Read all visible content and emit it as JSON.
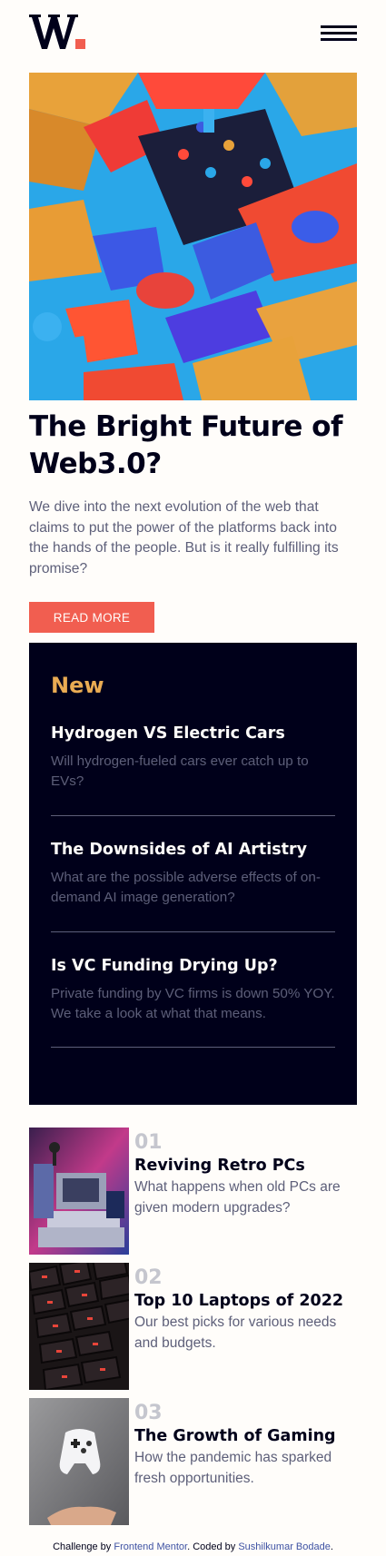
{
  "brand": {
    "logo_letter": "W",
    "logo_dot_color": "#f15e50"
  },
  "header": {
    "menu_icon": "hamburger-icon"
  },
  "hero": {
    "image_icon": "abstract-3d-shapes-image",
    "title": "The Bright Future of Web3.0?",
    "description": "We dive into the next evolution of the web that claims to put the power of the platforms back into the hands of the people. But is it really fulfilling its promise?",
    "button_label": "READ MORE"
  },
  "new_section": {
    "heading": "New",
    "items": [
      {
        "title": "Hydrogen VS Electric Cars",
        "description": "Will hydrogen-fueled cars ever catch up to EVs?"
      },
      {
        "title": "The Downsides of AI Artistry",
        "description": "What are the possible adverse effects of on-demand AI image generation?"
      },
      {
        "title": "Is VC Funding Drying Up?",
        "description": "Private funding by VC firms is down 50% YOY. We take a look at what that means."
      }
    ]
  },
  "articles": [
    {
      "number": "01",
      "title": "Reviving Retro PCs",
      "description": "What happens when old PCs are given modern upgrades?",
      "image_icon": "retro-pc-image"
    },
    {
      "number": "02",
      "title": "Top 10 Laptops of 2022",
      "description": "Our best picks for various needs and budgets.",
      "image_icon": "laptop-keyboard-image"
    },
    {
      "number": "03",
      "title": "The Growth of Gaming",
      "description": "How the pandemic has sparked fresh opportunities.",
      "image_icon": "game-controller-image"
    }
  ],
  "footer": {
    "prefix": "Challenge by",
    "link1": "Frontend Mentor",
    "middle": ". Coded by",
    "link2": "Sushilkumar Bodade",
    "suffix": "."
  },
  "colors": {
    "off_white": "#fffdfa",
    "very_dark_blue": "#00001a",
    "soft_red": "#f15e50",
    "soft_orange": "#e9ab53",
    "grayish_blue": "#5d5f79",
    "link_blue": "#3e52a3"
  }
}
